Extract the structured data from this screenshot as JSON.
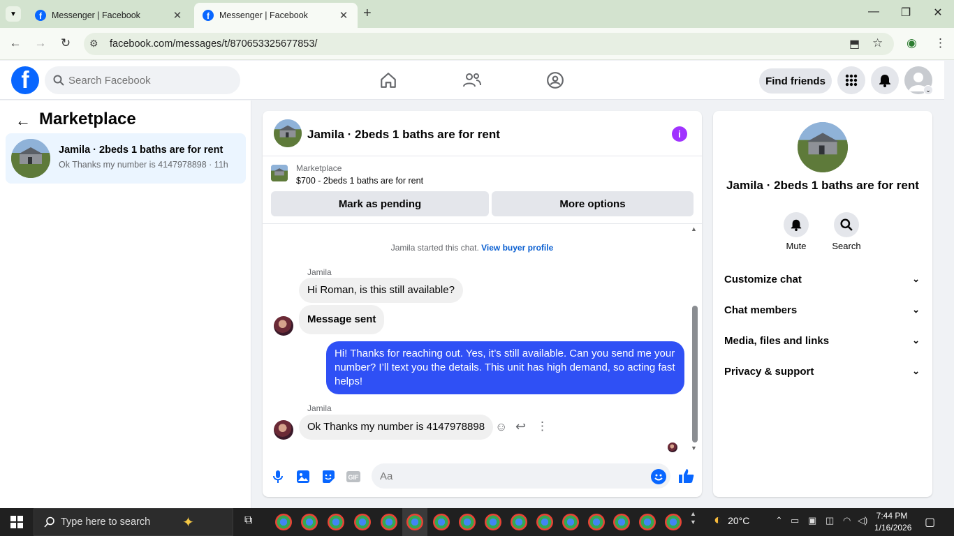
{
  "browser": {
    "tabs": [
      {
        "title": "Messenger | Facebook",
        "active": false
      },
      {
        "title": "Messenger | Facebook",
        "active": true
      }
    ],
    "url": "facebook.com/messages/t/870653325677853/"
  },
  "fb": {
    "search_placeholder": "Search Facebook",
    "find_friends": "Find friends"
  },
  "left": {
    "title": "Marketplace",
    "conversation": {
      "name": "Jamila · 2beds 1 baths are for rent",
      "preview": "Ok Thanks my number is 4147978898 · 11h"
    }
  },
  "chat": {
    "header_name": "Jamila · 2beds 1 baths are for rent",
    "marketplace_label": "Marketplace",
    "listing": "$700 - 2beds 1 baths are for rent",
    "mark_pending": "Mark as pending",
    "more_options": "More options",
    "started_text": "Jamila started this chat.",
    "view_profile": "View buyer profile",
    "sender": "Jamila",
    "messages": [
      "Hi Roman, is this still available?",
      "Message sent",
      "Hi! Thanks for reaching out. Yes, it’s still available. Can you send me your number? I’ll text you the details. This unit has high demand, so acting fast helps!",
      "Ok Thanks my number is 4147978898"
    ],
    "composer_placeholder": "Aa"
  },
  "right": {
    "name": "Jamila · 2beds 1 baths are for rent",
    "mute": "Mute",
    "search": "Search",
    "sections": [
      "Customize chat",
      "Chat members",
      "Media, files and links",
      "Privacy & support"
    ]
  },
  "taskbar": {
    "search_placeholder": "Type here to search",
    "temperature": "20°C",
    "time": "7:44 PM",
    "date": "1/16/2026"
  },
  "colors": {
    "fb_blue": "#0866ff",
    "outgoing_bubble": "#2f50f5",
    "info_purple": "#a033ff"
  }
}
